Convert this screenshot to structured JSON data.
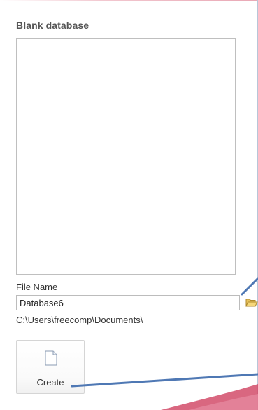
{
  "section": {
    "title": "Blank database"
  },
  "file_name": {
    "label": "File Name",
    "value": "Database6"
  },
  "save_path": "C:\\Users\\freecomp\\Documents\\",
  "create": {
    "label": "Create"
  },
  "icons": {
    "browse": "folder-open-icon",
    "create": "blank-document-icon"
  },
  "colors": {
    "callout": "#4f78b4",
    "border": "#bfbfbf",
    "accent_swoosh": "#d24c6a"
  }
}
